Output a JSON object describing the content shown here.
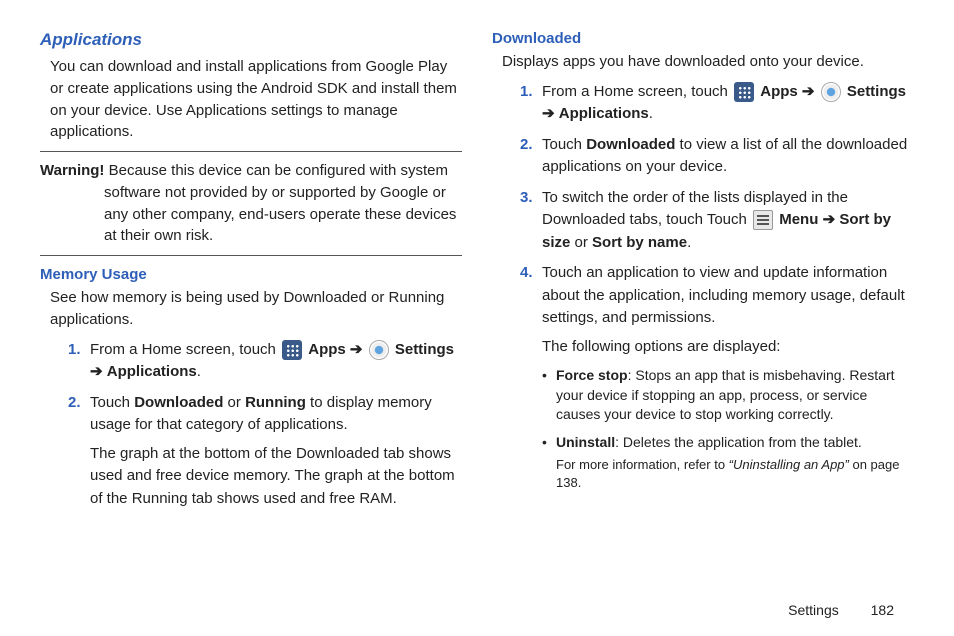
{
  "left": {
    "h_main": "Applications",
    "intro": "You can download and install applications from Google Play or create applications using the Android SDK and install them on your device. Use Applications settings to manage applications.",
    "warning_label": "Warning!",
    "warning_text": "Because this device can be configured with system software not provided by or supported by Google or any other company, end-users operate these devices at their own risk.",
    "h_sub": "Memory Usage",
    "sub_intro": "See how memory is being used by Downloaded or Running applications.",
    "steps": [
      {
        "num": "1.",
        "pre": "From a Home screen, touch ",
        "apps_label": "Apps",
        "arrow1": "➔",
        "settings_label": "Settings",
        "arrow2": "➔",
        "applications": "Applications",
        "period": "."
      },
      {
        "num": "2.",
        "pre": "Touch ",
        "dl": "Downloaded",
        "or": " or ",
        "run": "Running",
        "post": " to display memory usage for that category of applications.",
        "sub": "The graph at the bottom of the Downloaded tab shows used and free device memory. The graph at the bottom of the Running tab shows used and free RAM."
      }
    ]
  },
  "right": {
    "h_sub": "Downloaded",
    "intro": "Displays apps you have downloaded onto your device.",
    "steps": [
      {
        "num": "1.",
        "pre": "From a Home screen, touch ",
        "apps_label": "Apps",
        "arrow1": "➔",
        "settings_label": "Settings",
        "arrow2": "➔",
        "applications": "Applications",
        "period": "."
      },
      {
        "num": "2.",
        "pre": "Touch ",
        "dl": "Downloaded",
        "post": " to view a list of all the downloaded applications on your device."
      },
      {
        "num": "3.",
        "pre": "To switch the order of the lists displayed in the Downloaded tabs, touch Touch ",
        "menu_label": "Menu",
        "arrow1": "➔",
        "sort_size": "Sort by size",
        "or": " or ",
        "sort_name": "Sort by name",
        "period": "."
      },
      {
        "num": "4.",
        "text": "Touch an application to view and update information about the application, including memory usage, default settings, and permissions.",
        "sub": "The following options are displayed:"
      }
    ],
    "bullets": [
      {
        "label": "Force stop",
        "text": ": Stops an app that is misbehaving. Restart your device if stopping an app, process, or service causes your device to stop working correctly."
      },
      {
        "label": "Uninstall",
        "text": ": Deletes the application from the tablet.",
        "sub_pre": "For more information, refer to ",
        "sub_quote": "“Uninstalling an App”",
        "sub_post": "  on page 138."
      }
    ]
  },
  "footer": {
    "label": "Settings",
    "page": "182"
  }
}
